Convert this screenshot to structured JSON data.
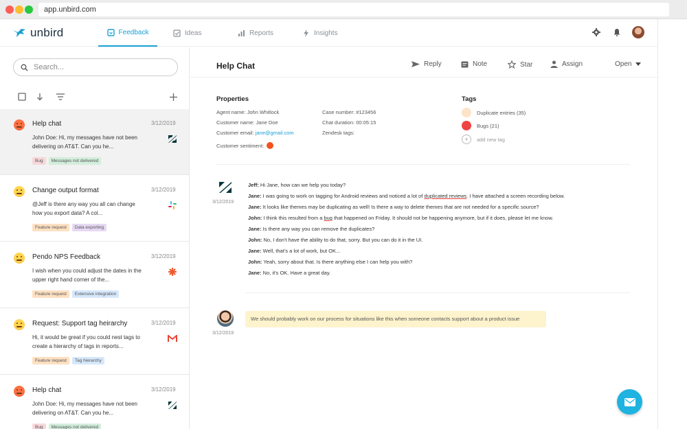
{
  "browser": {
    "url": "app.unbird.com"
  },
  "brand": {
    "name": "unbird",
    "accent": "#1aa0d4"
  },
  "nav": {
    "tabs": [
      {
        "label": "Feedback",
        "icon": "feedback-icon",
        "active": true
      },
      {
        "label": "Ideas",
        "icon": "ideas-icon",
        "active": false
      },
      {
        "label": "Reports",
        "icon": "reports-icon",
        "active": false
      },
      {
        "label": "Insights",
        "icon": "insights-icon",
        "active": false
      }
    ],
    "right_icons": [
      "settings-icon",
      "notifications-icon",
      "avatar"
    ]
  },
  "search": {
    "placeholder": "Search..."
  },
  "conversations": [
    {
      "title": "Help chat",
      "date": "3/12/2019",
      "sentiment": "angry",
      "source": "zendesk-icon",
      "snippet": "John Doe: Hi, my messages have not been delivering on AT&T. Can you he...",
      "tags": [
        {
          "label": "Bug",
          "color": "pink"
        },
        {
          "label": "Messages not delivered",
          "color": "green"
        }
      ]
    },
    {
      "title": "Change output format",
      "date": "3/12/2019",
      "sentiment": "neutral",
      "source": "slack-icon",
      "snippet": "@Jeff is there any way you all can change how you export data? A col...",
      "tags": [
        {
          "label": "Feature request",
          "color": "orange"
        },
        {
          "label": "Data exporting",
          "color": "purple"
        }
      ]
    },
    {
      "title": "Pendo NPS Feedback",
      "date": "3/12/2019",
      "sentiment": "neutral",
      "source": "pendo-icon",
      "snippet": "I wish when you could adjust the dates in the upper right hand corner of the...",
      "tags": [
        {
          "label": "Feature request",
          "color": "orange"
        },
        {
          "label": "Extensive integration",
          "color": "blue"
        }
      ]
    },
    {
      "title": "Request: Support tag heirarchy",
      "date": "3/12/2019",
      "sentiment": "neutral",
      "source": "gmail-icon",
      "snippet": "Hi, it would be great if you could nest tags to create a hierarchy of tags in reports...",
      "tags": [
        {
          "label": "Feature request",
          "color": "orange"
        },
        {
          "label": "Tag hierarchy",
          "color": "blue"
        }
      ]
    },
    {
      "title": "Help chat",
      "date": "3/12/2019",
      "sentiment": "angry",
      "source": "zendesk-icon",
      "snippet": "John Doe: Hi, my messages have not been delivering on AT&T. Can you he...",
      "tags": [
        {
          "label": "Bug",
          "color": "pink"
        },
        {
          "label": "Messages not delivered",
          "color": "green"
        }
      ]
    }
  ],
  "detail": {
    "title": "Help Chat",
    "actions": [
      "Reply",
      "Note",
      "Star",
      "Assign"
    ],
    "status": "Open",
    "properties_title": "Properties",
    "properties": {
      "agent": "Agent name: John Whitlock",
      "customer_name": "Customer name: Jane Doe",
      "customer_email_label": "Customer email: ",
      "customer_email": "jane@gmail.com",
      "sentiment_label": "Customer sentiment:",
      "case_number": "Case number: #123456",
      "chat_duration": "Chat duration: 00:05:15",
      "zendesk_tags": "Zendesk tags:"
    },
    "tags_title": "Tags",
    "tags": [
      {
        "label": "Duplicate entries (35)",
        "color": "#fde3c8"
      },
      {
        "label": "Bugs (21)",
        "color": "#ef4444"
      }
    ],
    "add_tag_label": "add new tag",
    "transcript_date": "3/12/2019",
    "transcript": [
      {
        "speaker": "Jeff:",
        "text": " Hi Jane, how can we help you today?"
      },
      {
        "speaker": "Jane:",
        "text_before": " I was going to work on tagging for Android reviews and noticed a lot of ",
        "underlined": "duplicated reviews",
        "text_after": ". I have attached a screen recording below."
      },
      {
        "speaker": "Jane:",
        "text": " It looks like themes may be duplicating as well! Is there a way to delete themes that are not needed for a specific source?"
      },
      {
        "speaker": "John:",
        "text_before": " I think this resulted from a ",
        "underlined": "bug",
        "text_after": " that happened on Friday. It should not be happening anymore, but if it does, please let me know."
      },
      {
        "speaker": "Jane:",
        "text": " Is there any way you can remove the duplicates?"
      },
      {
        "speaker": "John:",
        "text": " No, I don't have the ability to do that, sorry. But you can do it in the UI."
      },
      {
        "speaker": "Jane:",
        "text": " Well, that's a lot of work, but OK..."
      },
      {
        "speaker": "John:",
        "text": " Yeah, sorry about that. Is there anything else I can help you with?"
      },
      {
        "speaker": "Jane:",
        "text": " No, it's OK. Have a great day."
      }
    ],
    "note": {
      "text": "We should probably work on our process for situations like this when someone contacts support about a product issue",
      "date": "3/12/2019"
    }
  }
}
